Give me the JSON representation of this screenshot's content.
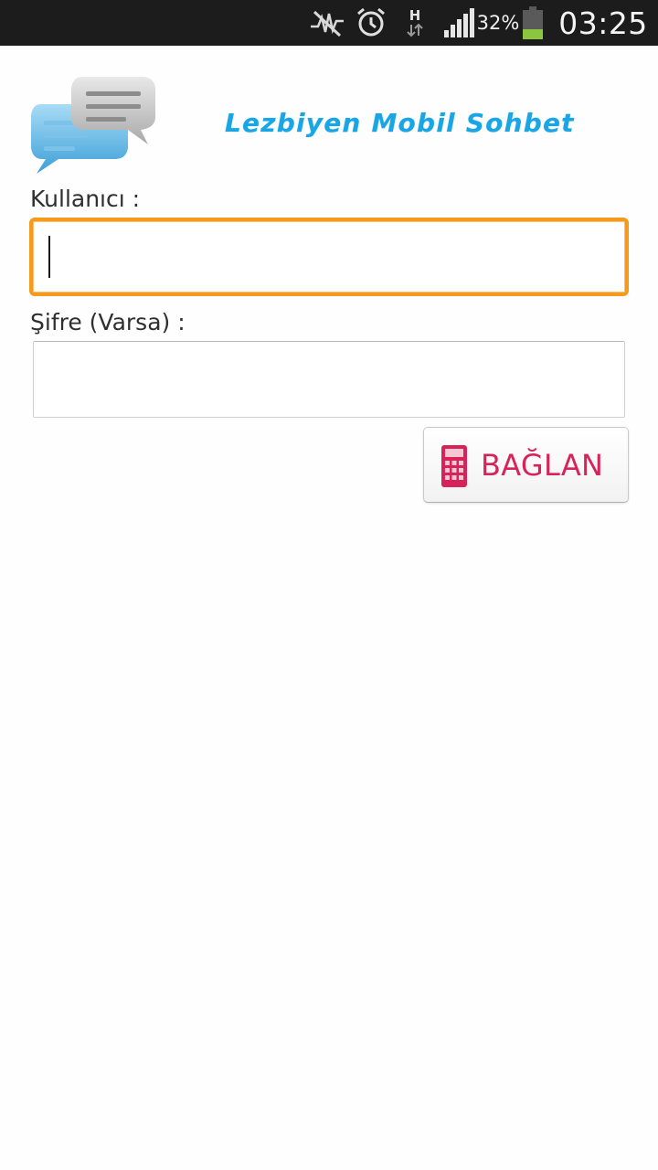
{
  "status_bar": {
    "icons": [
      "mute-icon",
      "alarm-icon",
      "data-hspa-icon",
      "signal-icon",
      "battery-icon"
    ],
    "network_type": "H",
    "battery_percent": "32%",
    "time": "03:25"
  },
  "header": {
    "logo_icon": "chat-bubbles-icon",
    "title": "Lezbiyen Mobil Sohbet",
    "title_color": "#1aa6e4"
  },
  "form": {
    "username_label": "Kullanıcı :",
    "username_value": "",
    "password_label": "Şifre (Varsa) :",
    "password_value": "",
    "focus_color": "#f59a1c",
    "connect_label": "BAĞLAN",
    "connect_icon": "calculator-icon",
    "connect_color": "#d6245a"
  }
}
